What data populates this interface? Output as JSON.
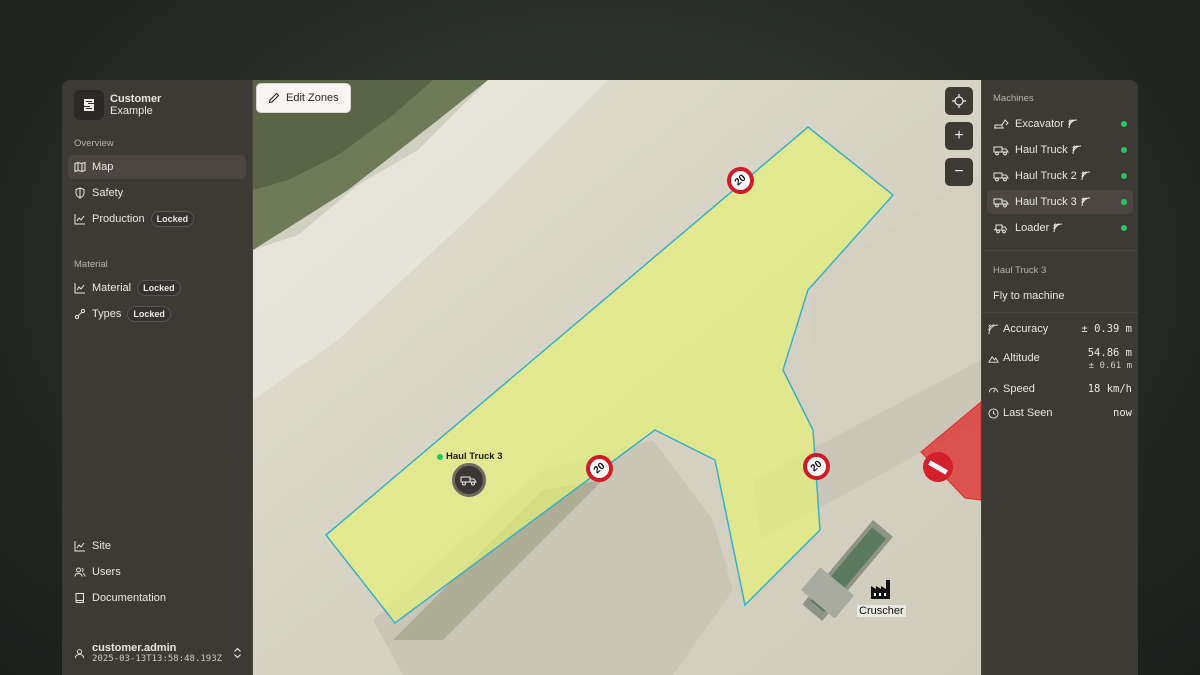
{
  "brand": {
    "name_line1": "Customer",
    "name_line2": "Example"
  },
  "sidebar": {
    "overview_label": "Overview",
    "overview_items": [
      {
        "label": "Map",
        "icon": "map-icon",
        "active": true
      },
      {
        "label": "Safety",
        "icon": "shield-icon"
      },
      {
        "label": "Production",
        "icon": "chart-icon",
        "badge": "Locked"
      }
    ],
    "material_label": "Material",
    "material_items": [
      {
        "label": "Material",
        "icon": "chart-icon",
        "badge": "Locked"
      },
      {
        "label": "Types",
        "icon": "types-icon",
        "badge": "Locked"
      }
    ],
    "bottom_items": [
      {
        "label": "Site",
        "icon": "chart-icon"
      },
      {
        "label": "Users",
        "icon": "users-icon"
      },
      {
        "label": "Documentation",
        "icon": "book-icon"
      }
    ],
    "user": {
      "name": "customer.admin",
      "timestamp": "2025-03-13T13:58:48.193Z"
    }
  },
  "map": {
    "edit_zones_label": "Edit Zones",
    "zoom_in": "+",
    "zoom_out": "−",
    "speed_signs": [
      "20",
      "20",
      "20"
    ],
    "truck_label": "Haul Truck 3",
    "crusher_label": "Cruscher",
    "colors": {
      "zone_fill": "#e5f07a",
      "zone_stroke": "#3ab0c8",
      "restricted": "#e02a2a"
    }
  },
  "panel": {
    "machines_label": "Machines",
    "machines": [
      {
        "label": "Excavator",
        "icon": "excavator-icon",
        "online": true
      },
      {
        "label": "Haul Truck",
        "icon": "truck-icon",
        "online": true
      },
      {
        "label": "Haul Truck 2",
        "icon": "truck-icon",
        "online": true
      },
      {
        "label": "Haul Truck 3",
        "icon": "truck-icon",
        "online": true,
        "active": true
      },
      {
        "label": "Loader",
        "icon": "loader-icon",
        "online": true
      }
    ],
    "detail": {
      "title": "Haul Truck 3",
      "fly_label": "Fly to machine",
      "accuracy_label": "Accuracy",
      "accuracy_value": "± 0.39 m",
      "altitude_label": "Altitude",
      "altitude_value": "54.86 m",
      "altitude_sub": "± 0.61 m",
      "speed_label": "Speed",
      "speed_value": "18 km/h",
      "last_seen_label": "Last Seen",
      "last_seen_value": "now"
    }
  }
}
